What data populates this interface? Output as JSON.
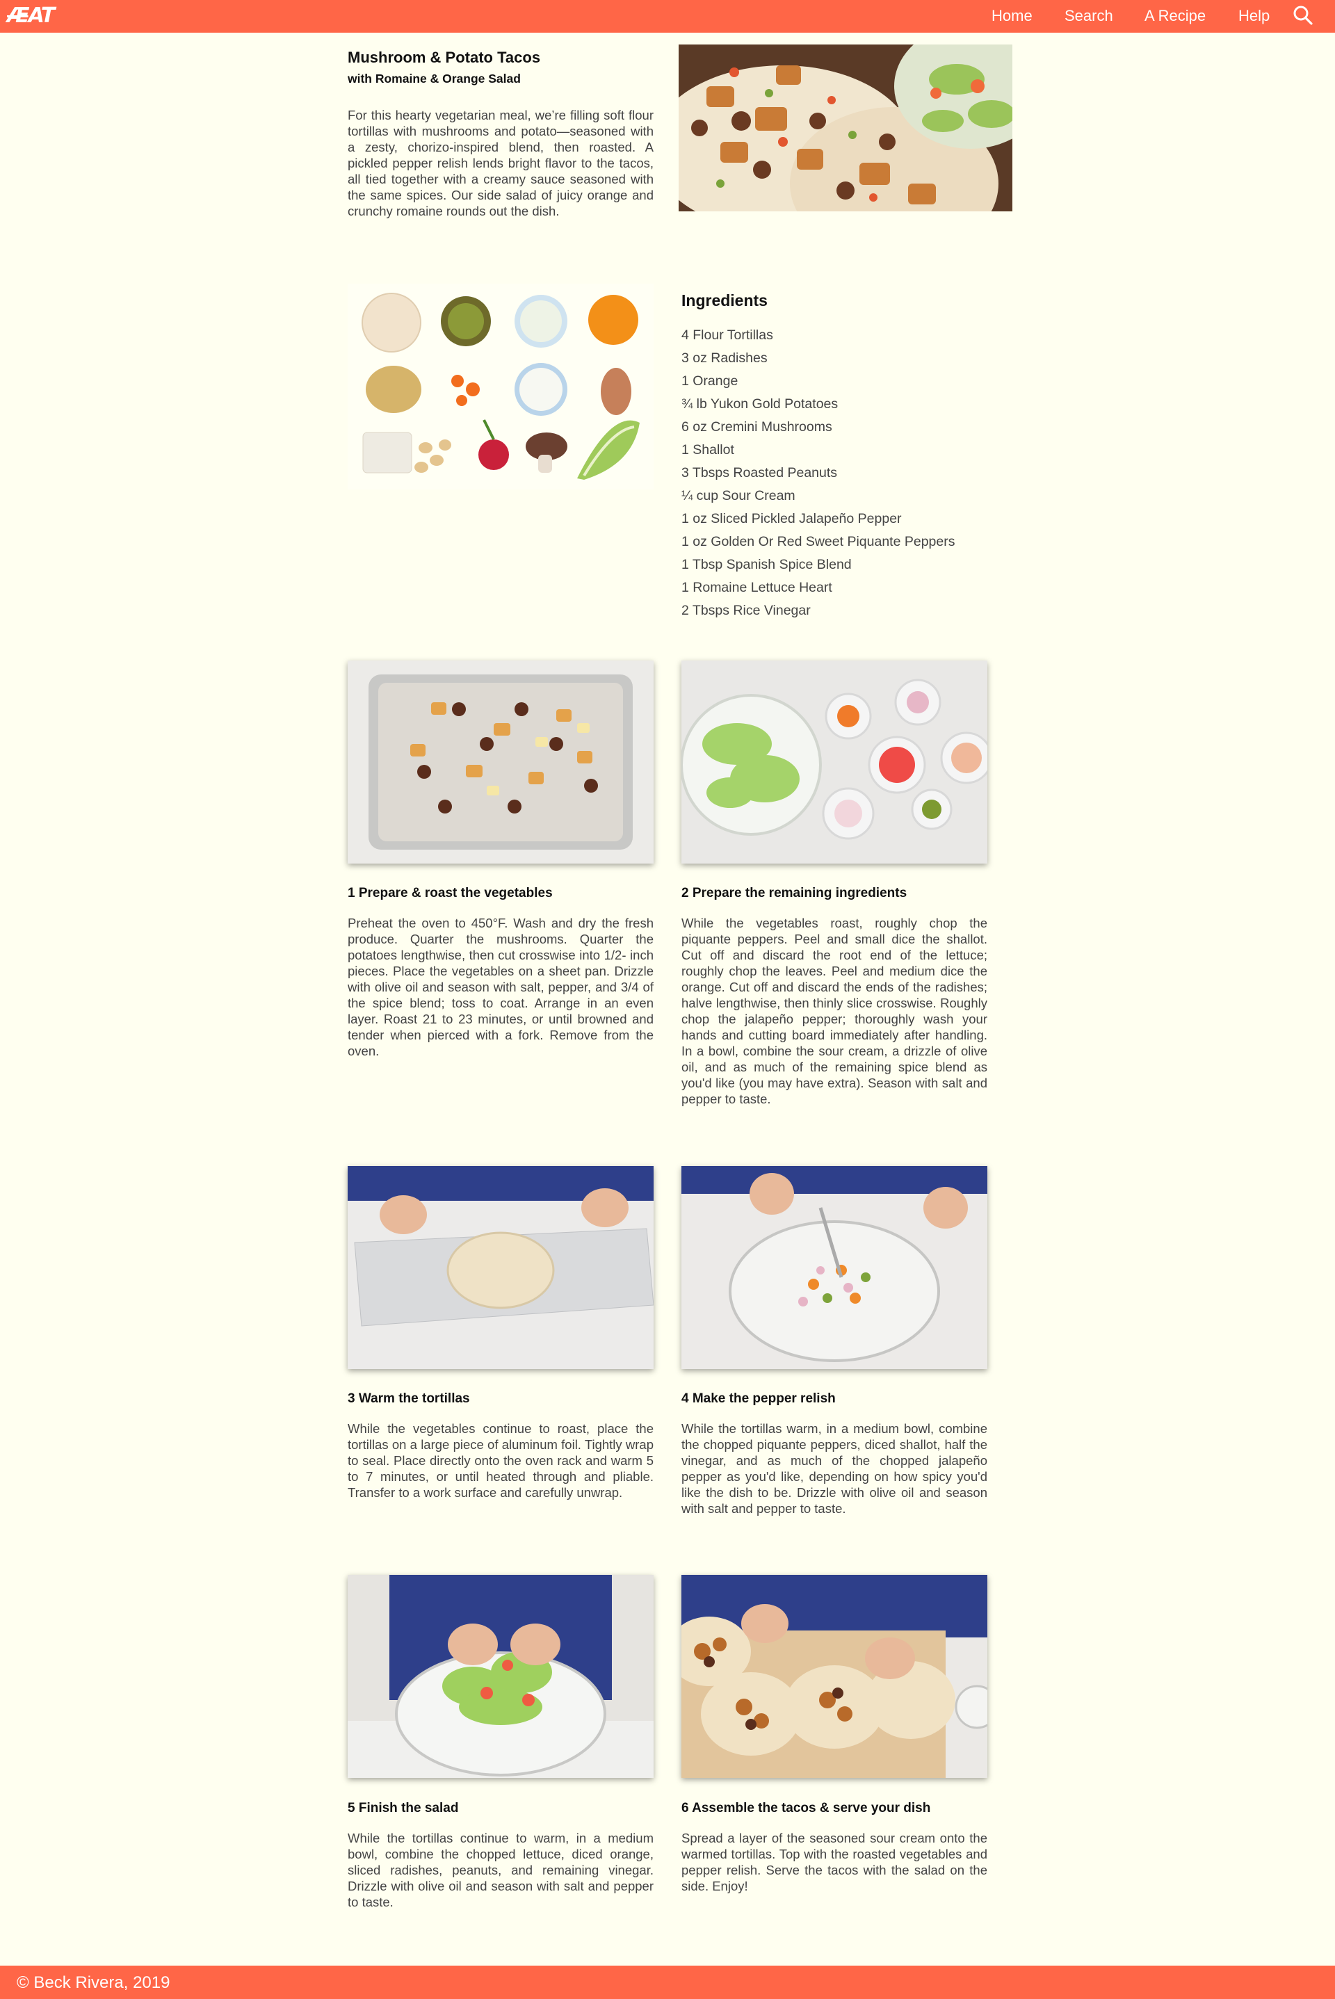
{
  "header": {
    "logo": "AEAT",
    "nav": [
      "Home",
      "Search",
      "A Recipe",
      "Help"
    ]
  },
  "recipe": {
    "title": "Mushroom & Potato Tacos",
    "subtitle": "with Romaine & Orange Salad",
    "description": "For this hearty vegetarian meal, we’re filling soft flour tortillas with mushrooms and potato—seasoned with a zesty, chorizo-inspired blend, then roasted. A pickled pepper relish lends bright flavor to the tacos, all tied together with a creamy sauce seasoned with the same spices. Our side salad of juicy orange and crunchy romaine rounds out the dish."
  },
  "ingredients": {
    "title": "Ingredients",
    "items": [
      "4 Flour Tortillas",
      "3 oz Radishes",
      "1 Orange",
      "¾ lb Yukon Gold Potatoes",
      "6 oz Cremini Mushrooms",
      "1 Shallot",
      "3 Tbsps Roasted Peanuts",
      "¼ cup Sour Cream",
      "1 oz Sliced Pickled Jalapeño Pepper",
      "1 oz Golden Or Red Sweet Piquante Peppers",
      "1 Tbsp Spanish Spice Blend",
      "1 Romaine Lettuce Heart",
      "2 Tbsps Rice Vinegar"
    ]
  },
  "steps": [
    {
      "title": "1 Prepare & roast the vegetables",
      "text": "Preheat the oven to 450°F. Wash and dry the fresh produce. Quarter the mushrooms. Quarter the potatoes lengthwise, then cut crosswise into 1/2- inch pieces. Place the vegetables on a sheet pan. Drizzle with olive oil and season with salt, pepper, and 3/4 of the spice blend; toss to coat. Arrange in an even layer. Roast 21 to 23 minutes, or until browned and tender when pierced with a fork. Remove from the oven."
    },
    {
      "title": "2 Prepare the remaining ingredients",
      "text": "While the vegetables roast, roughly chop the piquante peppers. Peel and small dice the shallot. Cut off and discard the root end of the lettuce; roughly chop the leaves. Peel and medium dice the orange. Cut off and discard the ends of the radishes; halve lengthwise, then thinly slice crosswise. Roughly chop the jalapeño pepper; thoroughly wash your hands and cutting board immediately after handling. In a bowl, combine the sour cream, a drizzle of olive oil, and as much of the remaining spice blend as you'd like (you may have extra). Season with salt and pepper to taste."
    },
    {
      "title": "3 Warm the tortillas",
      "text": "While the vegetables continue to roast, place the tortillas on a large piece of aluminum foil. Tightly wrap to seal. Place directly onto the oven rack and warm 5 to 7 minutes, or until heated through and pliable. Transfer to a work surface and carefully unwrap."
    },
    {
      "title": "4 Make the pepper relish",
      "text": "While the tortillas warm, in a medium bowl, combine the chopped piquante peppers, diced shallot, half the vinegar, and as much of the chopped jalapeño pepper as you'd like, depending on how spicy you'd like the dish to be. Drizzle with olive oil and season with salt and pepper to taste."
    },
    {
      "title": "5 Finish the salad",
      "text": "While the tortillas continue to warm, in a medium bowl, combine the chopped lettuce, diced orange, sliced radishes, peanuts, and remaining vinegar. Drizzle with olive oil and season with salt and pepper to taste."
    },
    {
      "title": "6 Assemble the tacos & serve your dish",
      "text": "Spread a layer of the seasoned sour cream onto the warmed tortillas. Top with the roasted vegetables and pepper relish. Serve the tacos with the salad on the side. Enjoy!"
    }
  ],
  "footer": {
    "copyright": "© Beck Rivera, 2019"
  },
  "icons": {
    "search": "search-icon"
  },
  "colors": {
    "brand": "#ff6647",
    "background": "#fffff0"
  }
}
